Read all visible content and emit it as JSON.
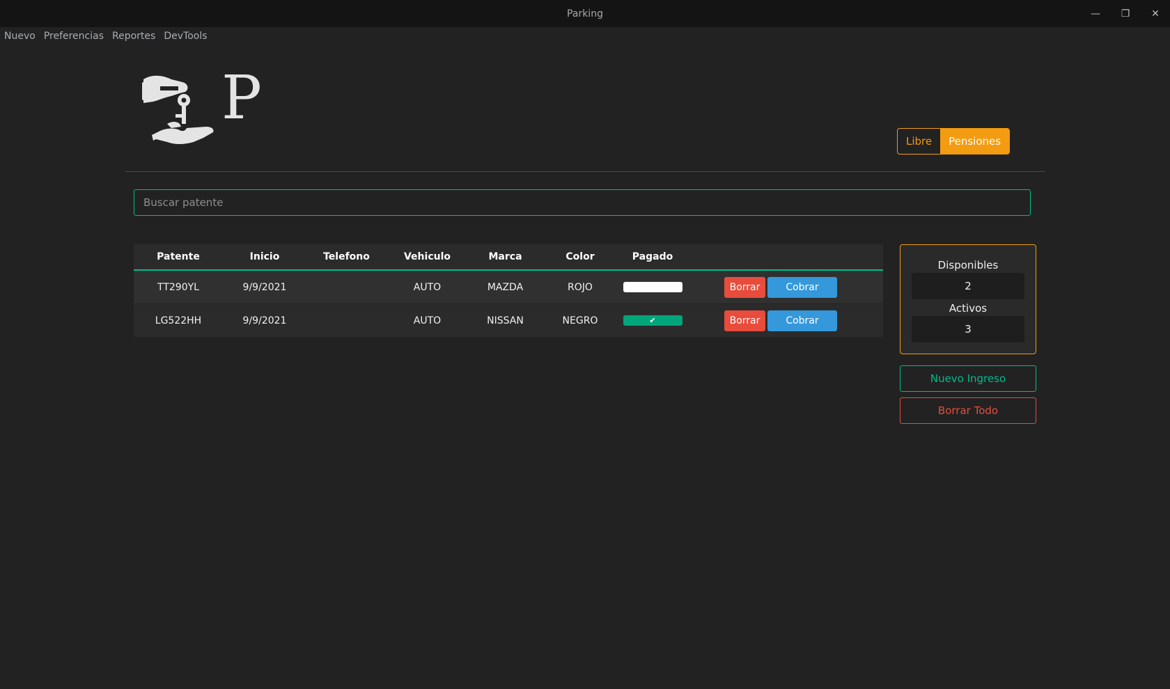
{
  "window": {
    "title": "Parking",
    "controls": {
      "minimize": "—",
      "restore": "❐",
      "close": "✕"
    }
  },
  "menu": [
    "Nuevo",
    "Preferencias",
    "Reportes",
    "DevTools"
  ],
  "logo": {
    "icon": "hand-key-icon",
    "letter": "P"
  },
  "mode_toggle": {
    "libre": "Libre",
    "pensiones": "Pensiones",
    "selected": "Pensiones"
  },
  "search": {
    "placeholder": "Buscar patente",
    "value": ""
  },
  "table": {
    "headers": [
      "Patente",
      "Inicio",
      "Telefono",
      "Vehiculo",
      "Marca",
      "Color",
      "Pagado"
    ],
    "rows": [
      {
        "patente": "TT290YL",
        "inicio": "9/9/2021",
        "telefono": "",
        "vehiculo": "AUTO",
        "marca": "MAZDA",
        "color": "ROJO",
        "pagado": false
      },
      {
        "patente": "LG522HH",
        "inicio": "9/9/2021",
        "telefono": "",
        "vehiculo": "AUTO",
        "marca": "NISSAN",
        "color": "NEGRO",
        "pagado": true
      }
    ],
    "borrar_label": "Borrar",
    "cobrar_label": "Cobrar",
    "paid_mark": "✔"
  },
  "stats": {
    "disponibles_label": "Disponibles",
    "disponibles_value": "2",
    "activos_label": "Activos",
    "activos_value": "3"
  },
  "actions": {
    "nuevo_ingreso": "Nuevo Ingreso",
    "borrar_todo": "Borrar Todo"
  },
  "colors": {
    "accent_green": "#00bc8c",
    "accent_orange": "#f39c12",
    "danger": "#e74c3c",
    "info": "#3498db",
    "background": "#222222"
  }
}
